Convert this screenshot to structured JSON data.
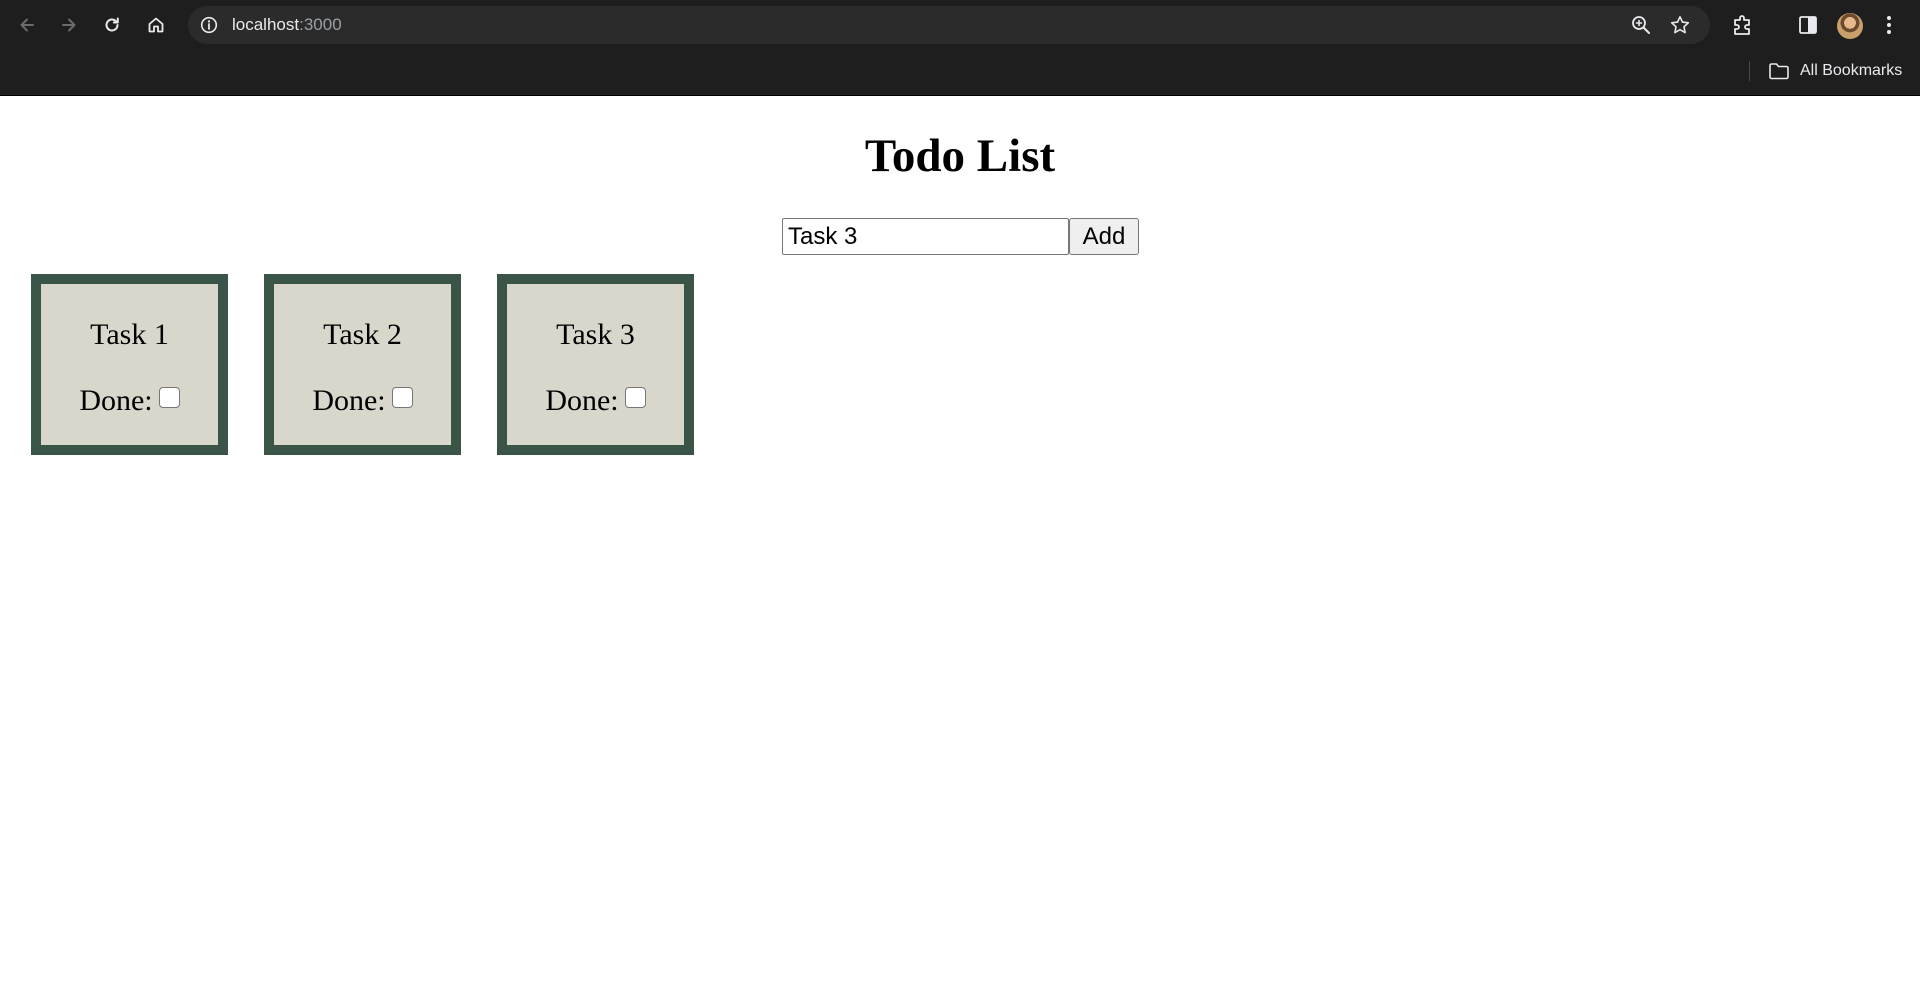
{
  "browser": {
    "url_host": "localhost",
    "url_port": ":3000",
    "bookmarks_label": "All Bookmarks"
  },
  "page": {
    "title": "Todo List",
    "input_value": "Task 3",
    "add_label": "Add"
  },
  "tasks": [
    {
      "name": "Task 1",
      "done_label": "Done:",
      "done": false
    },
    {
      "name": "Task 2",
      "done_label": "Done:",
      "done": false
    },
    {
      "name": "Task 3",
      "done_label": "Done:",
      "done": false
    }
  ],
  "colors": {
    "card_border": "#3a5447",
    "card_background": "#d9d7cc",
    "chrome_background": "#1e1e1e"
  }
}
